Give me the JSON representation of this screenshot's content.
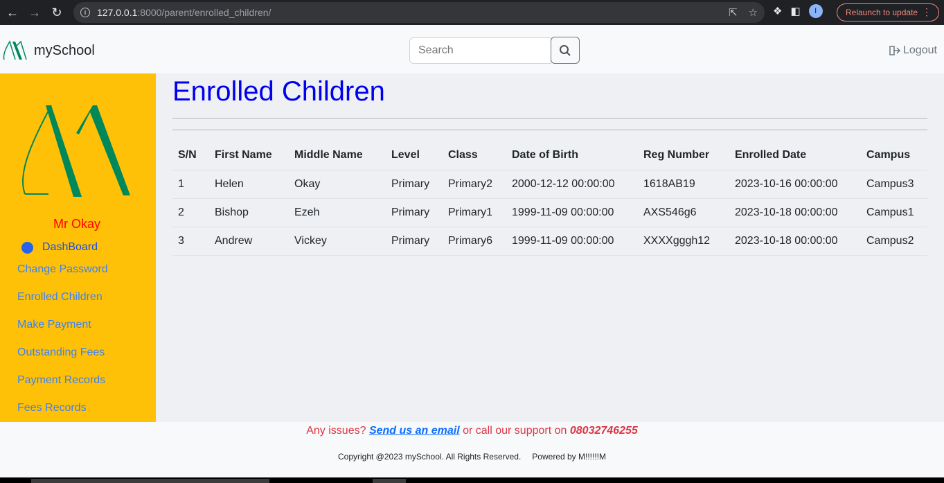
{
  "browser": {
    "url_host": "127.0.0.1",
    "url_path": ":8000/parent/enrolled_children/",
    "relaunch_label": "Relaunch to update",
    "profile_initial": "I"
  },
  "navbar": {
    "brand": "mySchool",
    "search_placeholder": "Search",
    "logout_label": "Logout"
  },
  "sidebar": {
    "user_name": "Mr Okay",
    "dashboard_label": "DashBoard",
    "links": [
      "Change Password",
      "Enrolled Children",
      "Make Payment",
      "Outstanding Fees",
      "Payment Records",
      "Fees Records"
    ]
  },
  "main": {
    "title": "Enrolled Children",
    "table": {
      "headers": [
        "S/N",
        "First Name",
        "Middle Name",
        "Level",
        "Class",
        "Date of Birth",
        "Reg Number",
        "Enrolled Date",
        "Campus"
      ],
      "rows": [
        [
          "1",
          "Helen",
          "Okay",
          "Primary",
          "Primary2",
          "2000-12-12 00:00:00",
          "1618AB19",
          "2023-10-16 00:00:00",
          "Campus3"
        ],
        [
          "2",
          "Bishop",
          "Ezeh",
          "Primary",
          "Primary1",
          "1999-11-09 00:00:00",
          "AXS546g6",
          "2023-10-18 00:00:00",
          "Campus1"
        ],
        [
          "3",
          "Andrew",
          "Vickey",
          "Primary",
          "Primary6",
          "1999-11-09 00:00:00",
          "XXXXgggh12",
          "2023-10-18 00:00:00",
          "Campus2"
        ]
      ]
    }
  },
  "footer": {
    "issues_prefix": "Any issues?",
    "email_link": "Send us an email",
    "support_text": "or call our support on",
    "phone": "08032746255",
    "copyright": "Copyright @2023 mySchool. All Rights Reserved.",
    "powered": "Powered by M!!!!!!M"
  },
  "colors": {
    "sidebar_bg": "#ffc107",
    "title": "#0000ee",
    "user_name": "#ff0000",
    "link": "#3b82f6",
    "brand_green": "#00875a"
  }
}
